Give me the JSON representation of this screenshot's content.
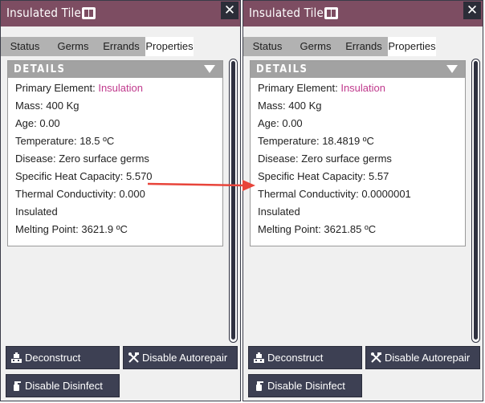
{
  "panels": [
    {
      "title": "Insulated Tile",
      "tabs": [
        "Status",
        "Germs",
        "Errands",
        "Properties"
      ],
      "active_tab": "Properties",
      "details": {
        "header": "DETAILS",
        "primary_element_label": "Primary Element:",
        "primary_element_value": "Insulation",
        "mass": "Mass: 400 Kg",
        "age": "Age: 0.00",
        "temperature": "Temperature: 18.5 ºC",
        "disease": "Disease: Zero surface germs",
        "specific_heat": "Specific Heat Capacity: 5.570",
        "thermal_conductivity": "Thermal Conductivity: 0.000",
        "insulated": "Insulated",
        "melting_point": "Melting Point: 3621.9 ºC"
      },
      "buttons": {
        "deconstruct": "Deconstruct",
        "disable_autorepair": "Disable Autorepair",
        "disable_disinfect": "Disable Disinfect"
      }
    },
    {
      "title": "Insulated Tile",
      "tabs": [
        "Status",
        "Germs",
        "Errands",
        "Properties"
      ],
      "active_tab": "Properties",
      "details": {
        "header": "DETAILS",
        "primary_element_label": "Primary Element:",
        "primary_element_value": "Insulation",
        "mass": "Mass: 400 Kg",
        "age": "Age: 0.00",
        "temperature": "Temperature: 18.4819 ºC",
        "disease": "Disease: Zero surface germs",
        "specific_heat": "Specific Heat Capacity: 5.57",
        "thermal_conductivity": "Thermal Conductivity: 0.0000001",
        "insulated": "Insulated",
        "melting_point": "Melting Point: 3621.85 ºC"
      },
      "buttons": {
        "deconstruct": "Deconstruct",
        "disable_autorepair": "Disable Autorepair",
        "disable_disinfect": "Disable Disinfect"
      }
    }
  ],
  "icons": {
    "close": "close-icon",
    "codex": "codex-book-icon",
    "collapse": "triangle-down-icon",
    "deconstruct": "deconstruct-icon",
    "autorepair": "wrench-hammer-icon",
    "disinfect": "spray-bottle-icon"
  },
  "colors": {
    "titlebar": "#7d4d62",
    "accent_text": "#c03a8d",
    "button_bg": "#3d4053",
    "arrow": "#e8443a"
  }
}
